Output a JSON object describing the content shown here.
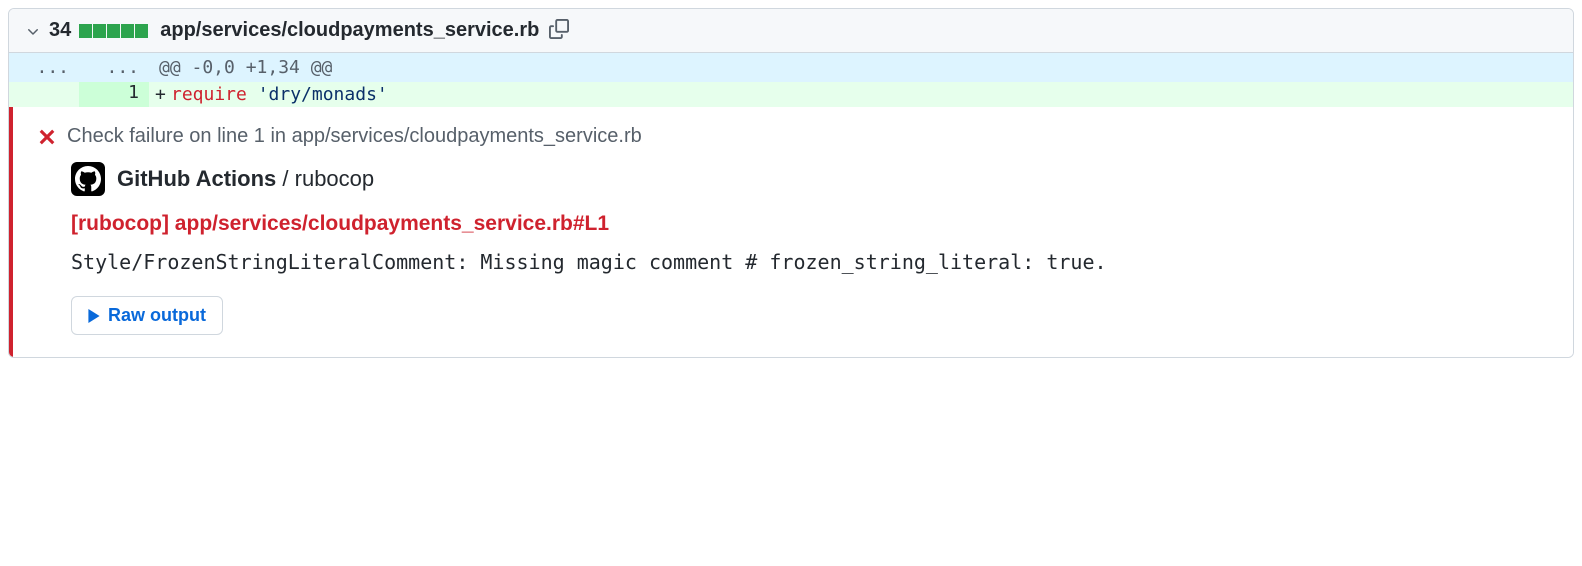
{
  "file": {
    "change_count": "34",
    "path": "app/services/cloudpayments_service.rb",
    "diff_segments": 5
  },
  "hunk": {
    "left_marker": "...",
    "right_marker": "...",
    "header": "@@ -0,0 +1,34 @@"
  },
  "lines": [
    {
      "old_num": "",
      "new_num": "1",
      "marker": "+",
      "code_html": "<span class=\"kw-require\">require</span> <span class=\"str\">'dry/monads'</span>"
    }
  ],
  "annotation": {
    "title": "Check failure on line 1 in app/services/cloudpayments_service.rb",
    "source_bold": "GitHub Actions",
    "source_normal": " / rubocop",
    "rule_link": "[rubocop] app/services/cloudpayments_service.rb#L1",
    "message": "Style/FrozenStringLiteralComment: Missing magic comment # frozen_string_literal: true.",
    "raw_output_label": "Raw output"
  }
}
